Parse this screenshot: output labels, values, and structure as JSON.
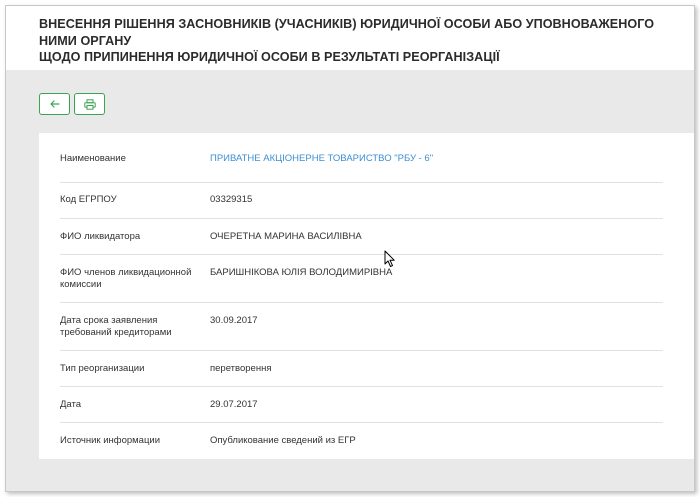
{
  "header": {
    "title_line1": "ВНЕСЕННЯ РІШЕННЯ ЗАСНОВНИКІВ (УЧАСНИКІВ) ЮРИДИЧНОЇ ОСОБИ АБО УПОВНОВАЖЕНОГО НИМИ ОРГАНУ",
    "title_line2": "ЩОДО ПРИПИНЕННЯ ЮРИДИЧНОЇ ОСОБИ В РЕЗУЛЬТАТІ РЕОРГАНІЗАЦІЇ"
  },
  "toolbar": {
    "back_icon": "arrow-left-icon",
    "print_icon": "printer-icon"
  },
  "colors": {
    "accent": "#3aa354",
    "link": "#3d8fd1",
    "background": "#e9e9e9"
  },
  "details": {
    "rows": [
      {
        "label": "Наименование",
        "value": "ПРИВАТНЕ АКЦІОНЕРНЕ ТОВАРИСТВО \"РБУ - 6\""
      },
      {
        "label": "Код ЕГРПОУ",
        "value": "03329315"
      },
      {
        "label": "ФИО ликвидатора",
        "value": "ОЧЕРЕТНА МАРИНА ВАСИЛІВНА"
      },
      {
        "label": "ФИО членов ликвидационной комиссии",
        "value": "БАРИШНІКОВА ЮЛІЯ ВОЛОДИМИРІВНА"
      },
      {
        "label": "Дата срока заявления требований кредиторами",
        "value": "30.09.2017"
      },
      {
        "label": "Тип реорганизации",
        "value": "перетворення"
      },
      {
        "label": "Дата",
        "value": "29.07.2017"
      },
      {
        "label": "Источник информации",
        "value": "Опубликование сведений из ЕГР"
      }
    ]
  }
}
